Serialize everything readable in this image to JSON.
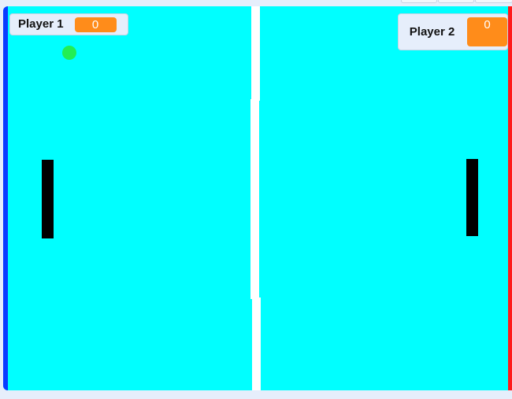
{
  "game": {
    "colors": {
      "field": "#00ffff",
      "left_wall": "#0a3cff",
      "right_wall": "#ff1a1a",
      "net": "#ffffff",
      "paddle": "#000000",
      "ball": "#22ee55",
      "score_badge": "#ff8c1a",
      "panel": "#e6eefb"
    },
    "scoreboard": {
      "player1": {
        "label": "Player 1",
        "score": "0"
      },
      "player2": {
        "label": "Player 2",
        "score": "0"
      }
    }
  }
}
